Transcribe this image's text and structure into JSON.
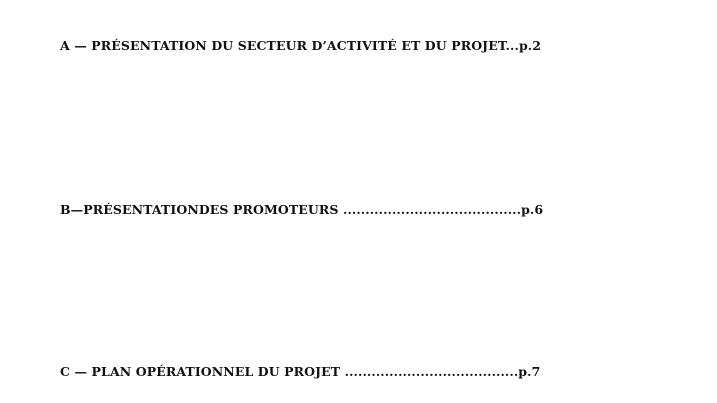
{
  "toc": {
    "entries": [
      {
        "text": "A —  PRÉSENTATION DU SECTEUR D’ACTIVITÉ ET DU PROJET...p.2"
      },
      {
        "text": "B—PRÉSENTATIONDES PROMOTEURS ........................................p.6"
      },
      {
        "text": "C — PLAN OPÉRATIONNEL DU PROJET .......................................p.7"
      }
    ]
  }
}
